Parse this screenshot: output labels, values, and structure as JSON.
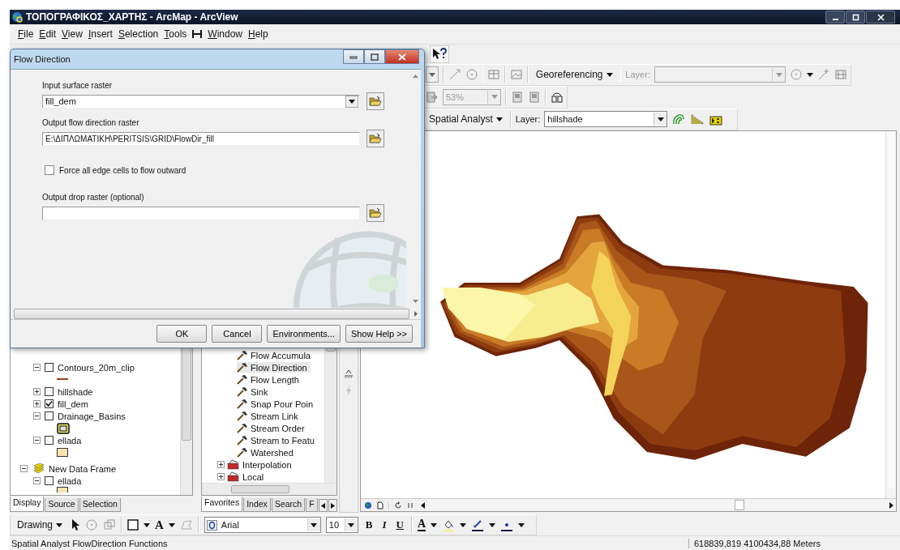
{
  "window": {
    "title": "ΤΟΠΟΓΡΑΦΙΚΟΣ_ΧΑΡΤΗΣ - ArcMap - ArcView"
  },
  "menu": [
    {
      "kind": "menu",
      "label": "File"
    },
    {
      "kind": "menu",
      "label": "Edit"
    },
    {
      "kind": "menu",
      "label": "View"
    },
    {
      "kind": "menu",
      "label": "Insert"
    },
    {
      "kind": "menu",
      "label": "Selection"
    },
    {
      "kind": "menu",
      "label": "Tools"
    },
    {
      "kind": "icon"
    },
    {
      "kind": "menu",
      "label": "Window"
    },
    {
      "kind": "menu",
      "label": "Help"
    }
  ],
  "toolbars": {
    "georeferencing": {
      "label": "Georeferencing",
      "layer_label": "Layer:"
    },
    "layout": {
      "zoom": "53%"
    },
    "spatial_analyst": {
      "label": "Spatial Analyst",
      "layer_label": "Layer:",
      "layer": "hillshade"
    }
  },
  "dialog": {
    "title": "Flow Direction",
    "fields": [
      {
        "kind": "combo",
        "label": "Input surface raster",
        "value": "fill_dem"
      },
      {
        "kind": "text",
        "label": "Output flow direction raster",
        "value": "E:\\ΔΙΠΛΩΜΑΤΙΚΗ\\PERITSIS\\GRID\\FlowDir_fill"
      },
      {
        "kind": "checkbox",
        "label": "Force all edge cells to flow outward",
        "checked": false
      },
      {
        "kind": "text",
        "label": "Output drop raster (optional)"
      }
    ],
    "buttons": [
      "OK",
      "Cancel",
      "Environments...",
      "Show Help >>"
    ]
  },
  "toc": {
    "items": [
      {
        "kind": "layer",
        "name": "Contours_20m_clip",
        "expanded": true,
        "checked": false,
        "legend": {
          "kind": "line"
        }
      },
      {
        "kind": "layer",
        "name": "hillshade",
        "expanded": false,
        "checked": false
      },
      {
        "kind": "layer",
        "name": "fill_dem",
        "expanded": false,
        "checked": true
      },
      {
        "kind": "layer",
        "name": "Drainage_Basins",
        "expanded": true,
        "checked": false,
        "legend": {
          "kind": "frame"
        }
      },
      {
        "kind": "layer",
        "name": "ellada",
        "expanded": true,
        "checked": false,
        "legend": {
          "kind": "fill"
        }
      },
      {
        "kind": "frame",
        "name": "New Data Frame",
        "expanded": true,
        "children": [
          {
            "kind": "layer",
            "name": "ellada",
            "expanded": true,
            "checked": false,
            "legend": {
              "kind": "fill"
            }
          }
        ]
      }
    ],
    "tabs": [
      {
        "label": "Display",
        "selected": true
      },
      {
        "label": "Source",
        "selected": false
      },
      {
        "label": "Selection",
        "selected": false
      }
    ]
  },
  "toolbox": {
    "items": [
      {
        "kind": "tool",
        "label": "Flow Accumula",
        "selected": false
      },
      {
        "kind": "tool",
        "label": "Flow Direction",
        "selected": true
      },
      {
        "kind": "tool",
        "label": "Flow Length",
        "selected": false
      },
      {
        "kind": "tool",
        "label": "Sink",
        "selected": false
      },
      {
        "kind": "tool",
        "label": "Snap Pour Poin",
        "selected": false
      },
      {
        "kind": "tool",
        "label": "Stream Link",
        "selected": false
      },
      {
        "kind": "tool",
        "label": "Stream Order",
        "selected": false
      },
      {
        "kind": "tool",
        "label": "Stream to Featu",
        "selected": false
      },
      {
        "kind": "tool",
        "label": "Watershed",
        "selected": false
      },
      {
        "kind": "toolset",
        "label": "Interpolation",
        "expanded": false
      },
      {
        "kind": "toolset",
        "label": "Local",
        "expanded": false
      }
    ],
    "tabs": [
      {
        "label": "Favorites",
        "selected": true
      },
      {
        "label": "Index",
        "selected": false
      },
      {
        "label": "Search",
        "selected": false
      },
      {
        "label": "F",
        "selected": false
      }
    ]
  },
  "drawing_toolbar": {
    "label": "Drawing",
    "text_button": "A",
    "font": "Arial",
    "size": "10",
    "bold": "B",
    "italic": "I",
    "underline": "U",
    "font_color": "A"
  },
  "status_bar": {
    "message": "Spatial Analyst FlowDirection Functions",
    "coordinates": "618839,819  4100434,88 Meters"
  }
}
